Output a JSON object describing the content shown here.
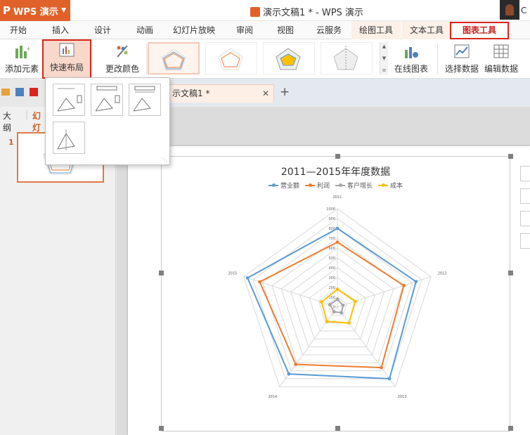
{
  "titlebar": {
    "app_name": "WPS 演示",
    "doc_title": "演示文稿1 * - WPS 演示",
    "user_short": "C"
  },
  "tabs": [
    {
      "label": "开始"
    },
    {
      "label": "插入"
    },
    {
      "label": "设计"
    },
    {
      "label": "动画"
    },
    {
      "label": "幻灯片放映"
    },
    {
      "label": "审阅"
    },
    {
      "label": "视图"
    },
    {
      "label": "云服务"
    },
    {
      "label": "绘图工具"
    },
    {
      "label": "文本工具"
    },
    {
      "label": "图表工具"
    }
  ],
  "ribbon": {
    "add_element": "添加元素",
    "quick_layout": "快速布局",
    "change_color": "更改颜色",
    "online_chart": "在线图表",
    "select_data": "选择数据",
    "edit_data": "编辑数据"
  },
  "doc_tab": {
    "label": "示文稿1 *"
  },
  "left_panel": {
    "tab_outline": "大纲",
    "tab_slides": "幻灯",
    "slide_number": "1"
  },
  "colors": {
    "accent": "#e0622a",
    "highlight": "#d9251c",
    "blue": "#5b9bd5",
    "orange": "#ed7d31",
    "gray": "#a5a5a5",
    "yellow": "#ffc000"
  },
  "chart_data": {
    "type": "radar",
    "title": "2011—2015年年度数据",
    "categories": [
      "2011",
      "2012",
      "2013",
      "2014",
      "2015"
    ],
    "radial_ticks": [
      "0",
      "100",
      "200",
      "300",
      "400",
      "500",
      "600",
      "700",
      "800",
      "900",
      "1000"
    ],
    "rlim": [
      0,
      1000
    ],
    "series": [
      {
        "name": "营业额",
        "color": "#5b9bd5",
        "values": [
          800,
          840,
          900,
          840,
          960
        ]
      },
      {
        "name": "利润",
        "color": "#ed7d31",
        "values": [
          660,
          710,
          760,
          720,
          830
        ]
      },
      {
        "name": "客户增长",
        "color": "#a5a5a5",
        "values": [
          80,
          60,
          70,
          60,
          80
        ]
      },
      {
        "name": "成本",
        "color": "#ffc000",
        "values": [
          180,
          190,
          200,
          180,
          170
        ]
      }
    ],
    "legend": "top",
    "grid": true
  }
}
